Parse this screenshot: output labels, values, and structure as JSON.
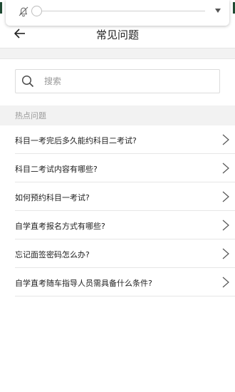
{
  "header": {
    "title": "常见问题"
  },
  "search": {
    "placeholder": "搜索"
  },
  "section": {
    "label": "热点问题"
  },
  "faq": [
    {
      "label": "科目一考完后多久能约科目二考试?"
    },
    {
      "label": "科目二考试内容有哪些?"
    },
    {
      "label": "如何预约科目一考试?"
    },
    {
      "label": "自学直考报名方式有哪些?"
    },
    {
      "label": "忘记面签密码怎么办?"
    },
    {
      "label": "自学直考随车指导人员需具备什么条件?"
    }
  ],
  "icons": {
    "overlay": [
      "bell-off-icon",
      "dropdown-arrow-icon"
    ],
    "header": "back-arrow-icon",
    "search": "search-icon",
    "row": "chevron-right-icon"
  },
  "colors": {
    "strip": "#1f4a33",
    "band": "#f2f2f2",
    "text": "#222222",
    "muted": "#999999"
  }
}
